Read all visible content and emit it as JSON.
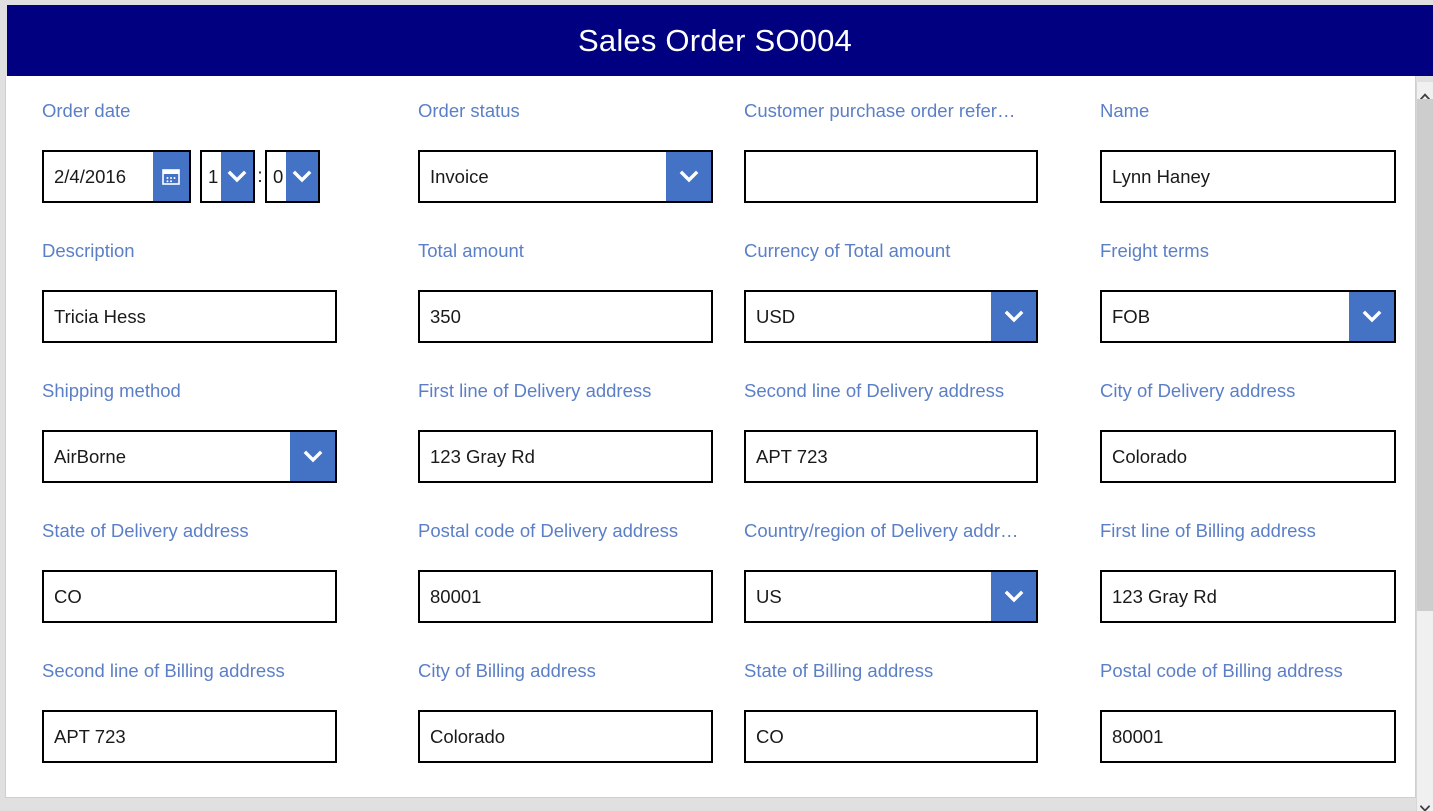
{
  "window": {
    "title": "Sales Order SO004",
    "header_bg": "#000080",
    "accent": "#4472c4",
    "label_color": "#5b7fc7",
    "required_marker": "*"
  },
  "form": {
    "rows": [
      {
        "fields": [
          {
            "label": "Order date",
            "required": true,
            "type": "datetime",
            "date_value": "2/4/2016",
            "hour_value": "1",
            "minute_value": "0",
            "time_separator": ":",
            "calendar_icon": "calendar-icon",
            "dropdown_icon": "chevron-down-icon"
          },
          {
            "label": "Order status",
            "required": true,
            "type": "select",
            "value": "Invoice",
            "dropdown_icon": "chevron-down-icon"
          },
          {
            "label": "Customer purchase order refer…",
            "required": false,
            "type": "text",
            "value": ""
          },
          {
            "label": "Name",
            "required": false,
            "type": "text",
            "value": "Lynn Haney"
          }
        ]
      },
      {
        "fields": [
          {
            "label": "Description",
            "required": false,
            "type": "text",
            "value": "Tricia Hess"
          },
          {
            "label": "Total amount",
            "required": true,
            "type": "text",
            "value": "350"
          },
          {
            "label": "Currency of Total amount",
            "required": true,
            "type": "select",
            "value": "USD",
            "dropdown_icon": "chevron-down-icon"
          },
          {
            "label": "Freight terms",
            "required": false,
            "type": "select",
            "value": "FOB",
            "dropdown_icon": "chevron-down-icon"
          }
        ]
      },
      {
        "fields": [
          {
            "label": "Shipping method",
            "required": false,
            "type": "select",
            "value": "AirBorne",
            "dropdown_icon": "chevron-down-icon"
          },
          {
            "label": "First line of Delivery address",
            "required": false,
            "type": "text",
            "value": "123 Gray Rd"
          },
          {
            "label": "Second line of Delivery address",
            "required": false,
            "type": "text",
            "value": "APT 723"
          },
          {
            "label": "City of Delivery address",
            "required": false,
            "type": "text",
            "value": "Colorado"
          }
        ]
      },
      {
        "fields": [
          {
            "label": "State of Delivery address",
            "required": false,
            "type": "text",
            "value": "CO"
          },
          {
            "label": "Postal code of Delivery address",
            "required": false,
            "type": "text",
            "value": "80001"
          },
          {
            "label": "Country/region of Delivery addr…",
            "required": false,
            "type": "select",
            "value": "US",
            "dropdown_icon": "chevron-down-icon"
          },
          {
            "label": "First line of Billing address",
            "required": false,
            "type": "text",
            "value": "123 Gray Rd"
          }
        ]
      },
      {
        "fields": [
          {
            "label": "Second line of Billing address",
            "required": false,
            "type": "text",
            "value": "APT 723"
          },
          {
            "label": "City of Billing address",
            "required": false,
            "type": "text",
            "value": "Colorado"
          },
          {
            "label": "State of Billing address",
            "required": false,
            "type": "text",
            "value": "CO"
          },
          {
            "label": "Postal code of Billing address",
            "required": false,
            "type": "text",
            "value": "80001"
          }
        ]
      }
    ]
  },
  "scrollbar": {
    "up_icon": "chevron-up-icon",
    "down_icon": "chevron-down-icon"
  }
}
